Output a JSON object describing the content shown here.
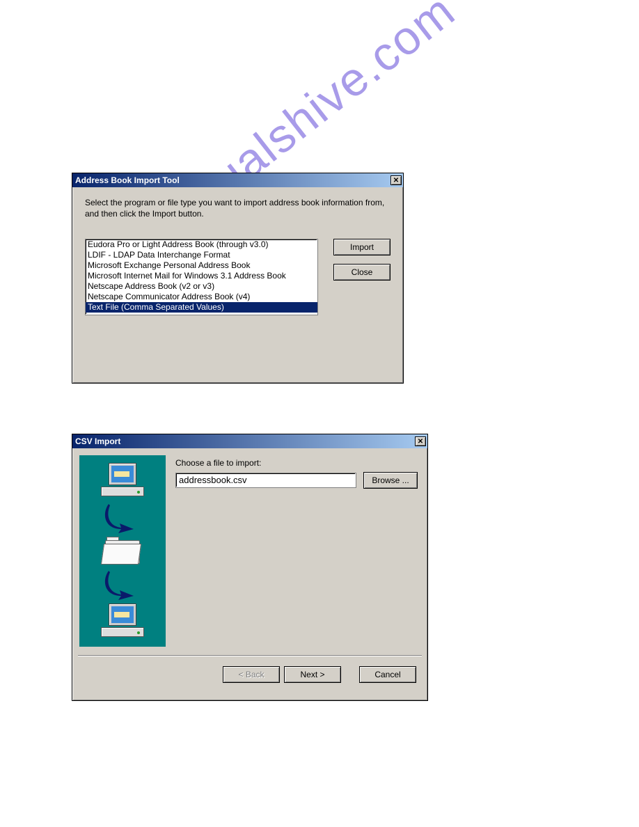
{
  "watermark_text": "manualshive.com",
  "dialog1": {
    "title": "Address Book Import Tool",
    "instruction": "Select the program or file type you want to import address book information from, and then click the Import button.",
    "list": [
      "Eudora Pro or Light Address Book (through v3.0)",
      "LDIF - LDAP Data Interchange Format",
      "Microsoft Exchange Personal Address Book",
      "Microsoft Internet Mail for Windows 3.1 Address Book",
      "Netscape Address Book (v2 or v3)",
      "Netscape Communicator Address Book (v4)",
      "Text File (Comma Separated Values)"
    ],
    "selected_index": 6,
    "buttons": {
      "import": "Import",
      "close": "Close"
    }
  },
  "dialog2": {
    "title": "CSV Import",
    "choose_label": "Choose a file to import:",
    "file_value": "addressbook.csv",
    "buttons": {
      "browse": "Browse ...",
      "back": "< Back",
      "next": "Next >",
      "cancel": "Cancel"
    }
  }
}
